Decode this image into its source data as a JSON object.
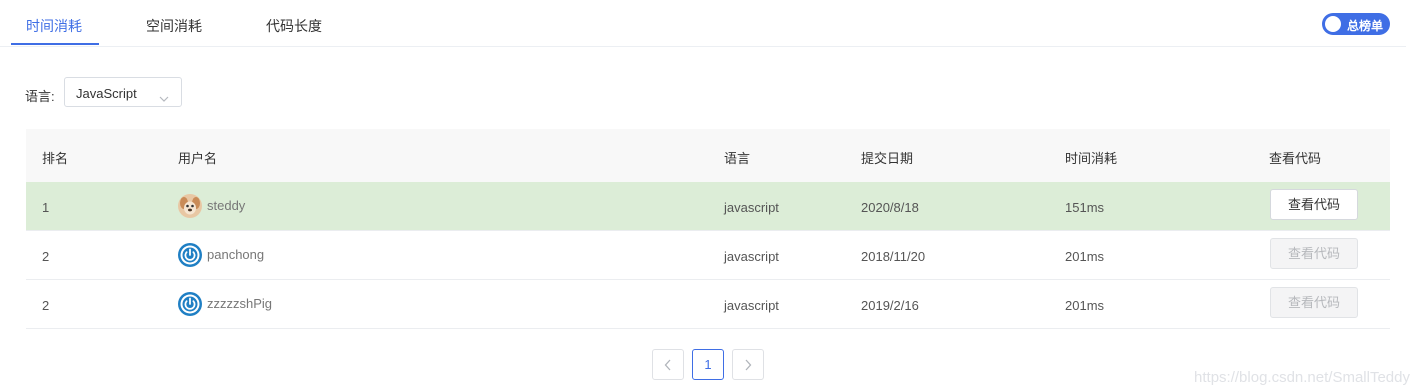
{
  "tabs": [
    {
      "label": "时间消耗",
      "active": true
    },
    {
      "label": "空间消耗",
      "active": false
    },
    {
      "label": "代码长度",
      "active": false
    }
  ],
  "toggle": {
    "label": "总榜单",
    "on": true
  },
  "filter": {
    "label": "语言:",
    "value": "JavaScript"
  },
  "table": {
    "headers": [
      "排名",
      "用户名",
      "语言",
      "提交日期",
      "时间消耗",
      "查看代码"
    ],
    "rows": [
      {
        "rank": "1",
        "user": "steddy",
        "lang": "javascript",
        "date": "2020/8/18",
        "time": "151ms",
        "button": "查看代码",
        "button_enabled": true,
        "highlight": true
      },
      {
        "rank": "2",
        "user": "panchong",
        "lang": "javascript",
        "date": "2018/11/20",
        "time": "201ms",
        "button": "查看代码",
        "button_enabled": false,
        "highlight": false
      },
      {
        "rank": "2",
        "user": "zzzzzshPig",
        "lang": "javascript",
        "date": "2019/2/16",
        "time": "201ms",
        "button": "查看代码",
        "button_enabled": false,
        "highlight": false
      }
    ]
  },
  "pagination": {
    "current": "1"
  },
  "icons": {
    "avatar_dog": "dog-avatar-icon",
    "avatar_power": "power-avatar-icon",
    "brand": "#3f6ee5"
  },
  "watermark": "https://blog.csdn.net/SmallTeddy"
}
